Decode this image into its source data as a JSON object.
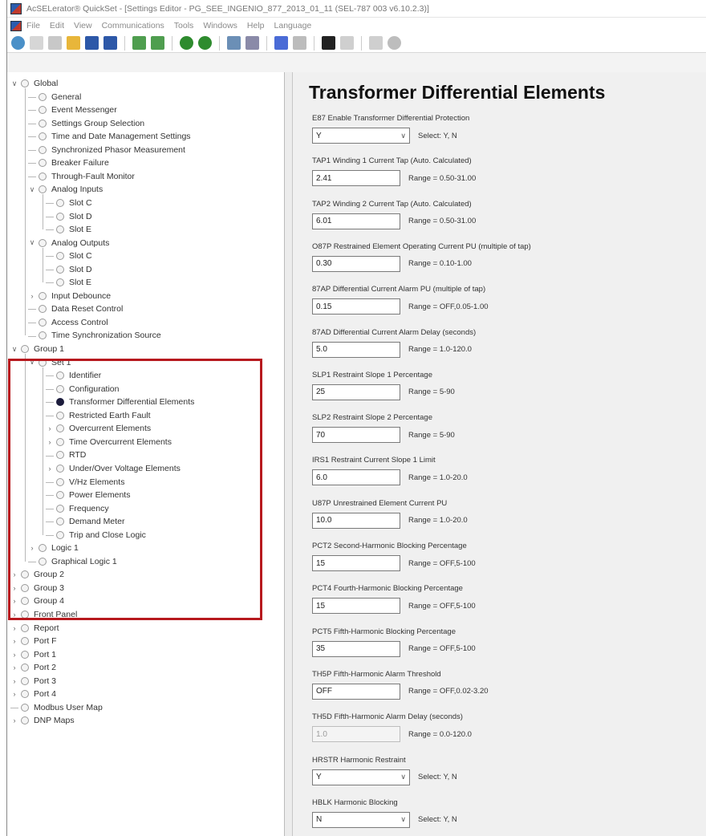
{
  "window": {
    "title": "AcSELerator® QuickSet - [Settings Editor - PG_SEE_INGENIO_877_2013_01_11 (SEL-787 003 v6.10.2.3)]"
  },
  "menubar": {
    "items": [
      "File",
      "Edit",
      "View",
      "Communications",
      "Tools",
      "Windows",
      "Help",
      "Language"
    ]
  },
  "toolbar": {
    "icons": [
      "refresh-icon",
      "copy-icon",
      "paste-icon",
      "open-folder-icon",
      "save-icon",
      "save-all-icon",
      "send-icon",
      "read-icon",
      "connect-icon",
      "disconnect-icon",
      "hmi-icon",
      "meter-icon",
      "events-icon",
      "terminal-icon",
      "monitor-icon",
      "doc-icon",
      "print-icon",
      "help-icon"
    ]
  },
  "tree": {
    "nodes": [
      {
        "label": "Global",
        "level": 0,
        "expander": "open"
      },
      {
        "label": "General",
        "level": 1
      },
      {
        "label": "Event Messenger",
        "level": 1
      },
      {
        "label": "Settings Group Selection",
        "level": 1
      },
      {
        "label": "Time and Date Management Settings",
        "level": 1
      },
      {
        "label": "Synchronized Phasor Measurement",
        "level": 1
      },
      {
        "label": "Breaker Failure",
        "level": 1
      },
      {
        "label": "Through-Fault Monitor",
        "level": 1
      },
      {
        "label": "Analog Inputs",
        "level": 1,
        "expander": "open"
      },
      {
        "label": "Slot C",
        "level": 2
      },
      {
        "label": "Slot D",
        "level": 2
      },
      {
        "label": "Slot E",
        "level": 2
      },
      {
        "label": "Analog Outputs",
        "level": 1,
        "expander": "open"
      },
      {
        "label": "Slot C",
        "level": 2
      },
      {
        "label": "Slot D",
        "level": 2
      },
      {
        "label": "Slot E",
        "level": 2
      },
      {
        "label": "Input Debounce",
        "level": 1,
        "expander": "closed"
      },
      {
        "label": "Data Reset Control",
        "level": 1
      },
      {
        "label": "Access Control",
        "level": 1
      },
      {
        "label": "Time Synchronization Source",
        "level": 1
      },
      {
        "label": "Group 1",
        "level": 0,
        "expander": "open"
      },
      {
        "label": "Set 1",
        "level": 1,
        "expander": "open"
      },
      {
        "label": "Identifier",
        "level": 2
      },
      {
        "label": "Configuration",
        "level": 2
      },
      {
        "label": "Transformer Differential Elements",
        "level": 2,
        "selected": true
      },
      {
        "label": "Restricted Earth Fault",
        "level": 2
      },
      {
        "label": "Overcurrent Elements",
        "level": 2,
        "expander": "closed"
      },
      {
        "label": "Time Overcurrent Elements",
        "level": 2,
        "expander": "closed"
      },
      {
        "label": "RTD",
        "level": 2
      },
      {
        "label": "Under/Over Voltage Elements",
        "level": 2,
        "expander": "closed"
      },
      {
        "label": "V/Hz Elements",
        "level": 2
      },
      {
        "label": "Power Elements",
        "level": 2
      },
      {
        "label": "Frequency",
        "level": 2
      },
      {
        "label": "Demand Meter",
        "level": 2
      },
      {
        "label": "Trip and Close Logic",
        "level": 2
      },
      {
        "label": "Logic 1",
        "level": 1,
        "expander": "closed"
      },
      {
        "label": "Graphical Logic 1",
        "level": 1
      },
      {
        "label": "Group 2",
        "level": 0,
        "expander": "closed"
      },
      {
        "label": "Group 3",
        "level": 0,
        "expander": "closed"
      },
      {
        "label": "Group 4",
        "level": 0,
        "expander": "closed"
      },
      {
        "label": "Front Panel",
        "level": 0,
        "expander": "closed"
      },
      {
        "label": "Report",
        "level": 0,
        "expander": "closed"
      },
      {
        "label": "Port F",
        "level": 0,
        "expander": "closed"
      },
      {
        "label": "Port 1",
        "level": 0,
        "expander": "closed"
      },
      {
        "label": "Port 2",
        "level": 0,
        "expander": "closed"
      },
      {
        "label": "Port 3",
        "level": 0,
        "expander": "closed"
      },
      {
        "label": "Port 4",
        "level": 0,
        "expander": "closed"
      },
      {
        "label": "Modbus User Map",
        "level": 0
      },
      {
        "label": "DNP Maps",
        "level": 0,
        "expander": "closed"
      }
    ]
  },
  "editor": {
    "title": "Transformer Differential Elements",
    "settings": [
      {
        "label": "E87 Enable Transformer Differential Protection",
        "control": "select",
        "value": "Y",
        "hint": "Select: Y, N"
      },
      {
        "label": "TAP1 Winding 1 Current Tap (Auto. Calculated)",
        "control": "text",
        "value": "2.41",
        "hint": "Range = 0.50-31.00"
      },
      {
        "label": "TAP2 Winding 2 Current Tap (Auto. Calculated)",
        "control": "text",
        "value": "6.01",
        "hint": "Range = 0.50-31.00"
      },
      {
        "label": "O87P Restrained Element Operating Current PU (multiple of tap)",
        "control": "text",
        "value": "0.30",
        "hint": "Range = 0.10-1.00"
      },
      {
        "label": "87AP Differential Current Alarm PU (multiple of tap)",
        "control": "text",
        "value": "0.15",
        "hint": "Range = OFF,0.05-1.00"
      },
      {
        "label": "87AD Differential Current Alarm Delay (seconds)",
        "control": "text",
        "value": "5.0",
        "hint": "Range = 1.0-120.0"
      },
      {
        "label": "SLP1 Restraint Slope 1 Percentage",
        "control": "text",
        "value": "25",
        "hint": "Range = 5-90"
      },
      {
        "label": "SLP2 Restraint Slope 2 Percentage",
        "control": "text",
        "value": "70",
        "hint": "Range = 5-90"
      },
      {
        "label": "IRS1 Restraint Current Slope 1 Limit",
        "control": "text",
        "value": "6.0",
        "hint": "Range = 1.0-20.0"
      },
      {
        "label": "U87P Unrestrained Element Current PU",
        "control": "text",
        "value": "10.0",
        "hint": "Range = 1.0-20.0"
      },
      {
        "label": "PCT2 Second-Harmonic Blocking Percentage",
        "control": "text",
        "value": "15",
        "hint": "Range = OFF,5-100"
      },
      {
        "label": "PCT4 Fourth-Harmonic Blocking Percentage",
        "control": "text",
        "value": "15",
        "hint": "Range = OFF,5-100"
      },
      {
        "label": "PCT5 Fifth-Harmonic Blocking Percentage",
        "control": "text",
        "value": "35",
        "hint": "Range = OFF,5-100"
      },
      {
        "label": "TH5P Fifth-Harmonic Alarm Threshold",
        "control": "text",
        "value": "OFF",
        "hint": "Range = OFF,0.02-3.20"
      },
      {
        "label": "TH5D Fifth-Harmonic Alarm Delay (seconds)",
        "control": "text",
        "value": "1.0",
        "hint": "Range = 0.0-120.0",
        "disabled": true
      },
      {
        "label": "HRSTR Harmonic Restraint",
        "control": "select",
        "value": "Y",
        "hint": "Select: Y, N"
      },
      {
        "label": "HBLK Harmonic Blocking",
        "control": "select",
        "value": "N",
        "hint": "Select: Y, N"
      }
    ]
  },
  "colors": {
    "highlight_box": "#b7191e",
    "selected_node": "#1c1c3c"
  }
}
